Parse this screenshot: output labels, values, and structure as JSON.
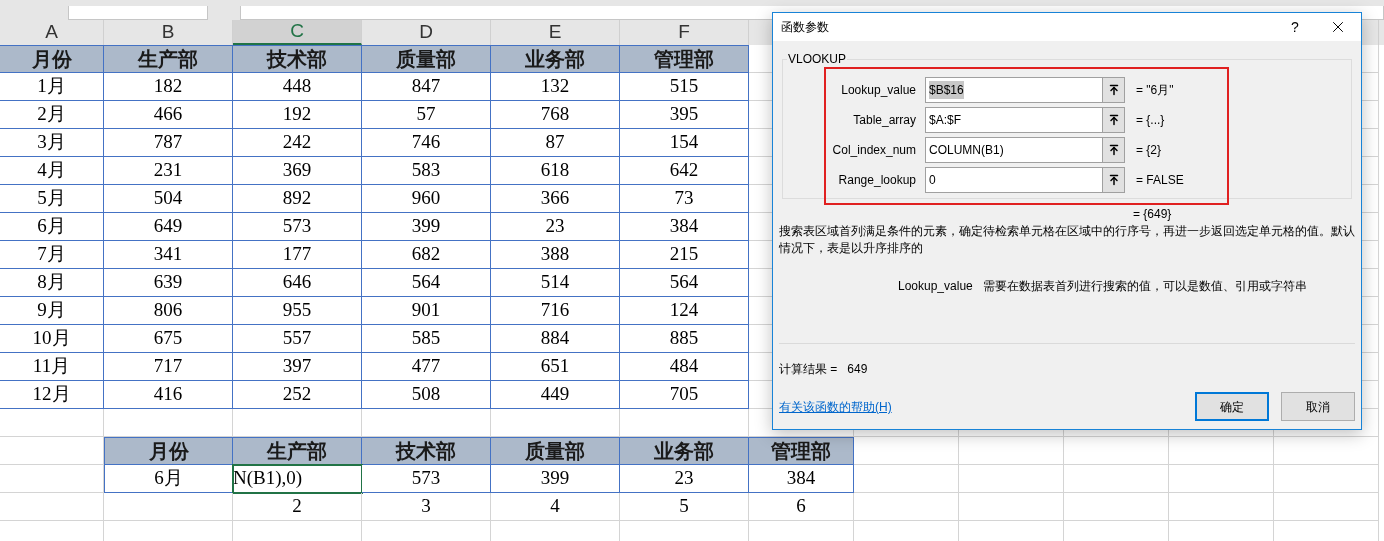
{
  "column_headers": [
    {
      "label": "A",
      "selected": false
    },
    {
      "label": "B",
      "selected": false
    },
    {
      "label": "C",
      "selected": true
    },
    {
      "label": "D",
      "selected": false
    },
    {
      "label": "E",
      "selected": false
    },
    {
      "label": "F",
      "selected": false
    }
  ],
  "table_1": {
    "header": [
      "月份",
      "生产部",
      "技术部",
      "质量部",
      "业务部",
      "管理部"
    ],
    "rows": [
      [
        "1月",
        "182",
        "448",
        "847",
        "132",
        "515"
      ],
      [
        "2月",
        "466",
        "192",
        "57",
        "768",
        "395"
      ],
      [
        "3月",
        "787",
        "242",
        "746",
        "87",
        "154"
      ],
      [
        "4月",
        "231",
        "369",
        "583",
        "618",
        "642"
      ],
      [
        "5月",
        "504",
        "892",
        "960",
        "366",
        "73"
      ],
      [
        "6月",
        "649",
        "573",
        "399",
        "23",
        "384"
      ],
      [
        "7月",
        "341",
        "177",
        "682",
        "388",
        "215"
      ],
      [
        "8月",
        "639",
        "646",
        "564",
        "514",
        "564"
      ],
      [
        "9月",
        "806",
        "955",
        "901",
        "716",
        "124"
      ],
      [
        "10月",
        "675",
        "557",
        "585",
        "884",
        "885"
      ],
      [
        "11月",
        "717",
        "397",
        "477",
        "651",
        "484"
      ],
      [
        "12月",
        "416",
        "252",
        "508",
        "449",
        "705"
      ]
    ]
  },
  "table_2": {
    "header": [
      "月份",
      "生产部",
      "技术部",
      "质量部",
      "业务部",
      "管理部"
    ],
    "row": [
      {
        "text": "6月",
        "selected": false
      },
      {
        "text": "N(B1),0)",
        "selected": true
      },
      {
        "text": "573",
        "selected": false
      },
      {
        "text": "399",
        "selected": false
      },
      {
        "text": "23",
        "selected": false
      },
      {
        "text": "384",
        "selected": false
      }
    ],
    "column_numbers": [
      "2",
      "3",
      "4",
      "5",
      "6"
    ]
  },
  "dialog": {
    "title": "函数参数",
    "help": "?",
    "function_name": "VLOOKUP",
    "arguments": [
      {
        "label": "Lookup_value",
        "value": "$B$16",
        "selected": true,
        "result": "= \"6月\""
      },
      {
        "label": "Table_array",
        "value": "$A:$F",
        "selected": false,
        "result": "= {...}"
      },
      {
        "label": "Col_index_num",
        "value": "COLUMN(B1)",
        "selected": false,
        "result": "= {2}"
      },
      {
        "label": "Range_lookup",
        "value": "0",
        "selected": false,
        "result": "= FALSE"
      }
    ],
    "formula_result": "= {649}",
    "description": "搜索表区域首列满足条件的元素，确定待检索单元格在区域中的行序号，再进一步返回选定单元格的值。默认情况下，表是以升序排序的",
    "argument_help": {
      "name": "Lookup_value",
      "text": "需要在数据表首列进行搜索的值，可以是数值、引用或字符串"
    },
    "result_label": "计算结果 =",
    "result_value": "649",
    "help_link": "有关该函数的帮助(H)",
    "buttons": [
      {
        "label": "确定",
        "selected": true
      },
      {
        "label": "取消",
        "selected": false
      }
    ]
  }
}
